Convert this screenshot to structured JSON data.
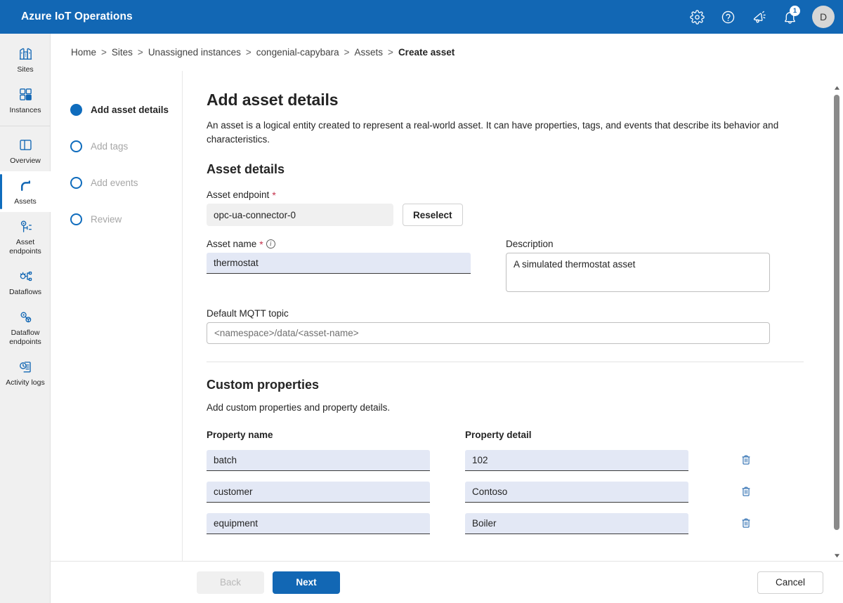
{
  "header": {
    "brand": "Azure IoT Operations",
    "accent_color": "#1267b4",
    "icons": [
      {
        "name": "settings-gear-icon",
        "label": "Settings"
      },
      {
        "name": "help-question-icon",
        "label": "Help"
      },
      {
        "name": "announcement-megaphone-icon",
        "label": "What's new"
      },
      {
        "name": "notifications-bell-icon",
        "label": "Notifications",
        "badge": "1"
      }
    ],
    "avatar_initial": "D"
  },
  "sidebar": {
    "items": [
      {
        "label": "Sites",
        "icon": "sites-icon",
        "active": false
      },
      {
        "label": "Instances",
        "icon": "instances-icon",
        "active": false
      },
      {
        "label": "Overview",
        "icon": "overview-icon",
        "active": false
      },
      {
        "label": "Assets",
        "icon": "assets-robot-arm-icon",
        "active": true
      },
      {
        "label": "Asset endpoints",
        "icon": "asset-endpoints-icon",
        "active": false
      },
      {
        "label": "Dataflows",
        "icon": "dataflows-icon",
        "active": false
      },
      {
        "label": "Dataflow endpoints",
        "icon": "dataflow-endpoints-icon",
        "active": false
      },
      {
        "label": "Activity logs",
        "icon": "activity-logs-icon",
        "active": false
      }
    ]
  },
  "breadcrumb": {
    "separator": ">",
    "items": [
      {
        "label": "Home",
        "current": false
      },
      {
        "label": "Sites",
        "current": false
      },
      {
        "label": "Unassigned instances",
        "current": false
      },
      {
        "label": "congenial-capybara",
        "current": false
      },
      {
        "label": "Assets",
        "current": false
      },
      {
        "label": "Create asset",
        "current": true
      }
    ]
  },
  "wizard": {
    "steps": [
      {
        "label": "Add asset details",
        "state": "current"
      },
      {
        "label": "Add tags",
        "state": "pending"
      },
      {
        "label": "Add events",
        "state": "pending"
      },
      {
        "label": "Review",
        "state": "pending"
      }
    ]
  },
  "main": {
    "title": "Add asset details",
    "description": "An asset is a logical entity created to represent a real-world asset. It can have properties, tags, and events that describe its behavior and characteristics.",
    "asset_details_heading": "Asset details",
    "asset_endpoint": {
      "label": "Asset endpoint",
      "required_mark": "*",
      "value": "opc-ua-connector-0",
      "reselect_label": "Reselect"
    },
    "asset_name": {
      "label": "Asset name",
      "required_mark": "*",
      "value": "thermostat"
    },
    "description_field": {
      "label": "Description",
      "value": "A simulated thermostat asset"
    },
    "mqtt_topic": {
      "label": "Default MQTT topic",
      "value": "",
      "placeholder": "<namespace>/data/<asset-name>"
    },
    "custom_properties": {
      "heading": "Custom properties",
      "description": "Add custom properties and property details.",
      "col_name_header": "Property name",
      "col_detail_header": "Property detail",
      "rows": [
        {
          "name": "batch",
          "detail": "102"
        },
        {
          "name": "customer",
          "detail": "Contoso"
        },
        {
          "name": "equipment",
          "detail": "Boiler"
        }
      ]
    }
  },
  "footer": {
    "back_label": "Back",
    "next_label": "Next",
    "cancel_label": "Cancel"
  }
}
